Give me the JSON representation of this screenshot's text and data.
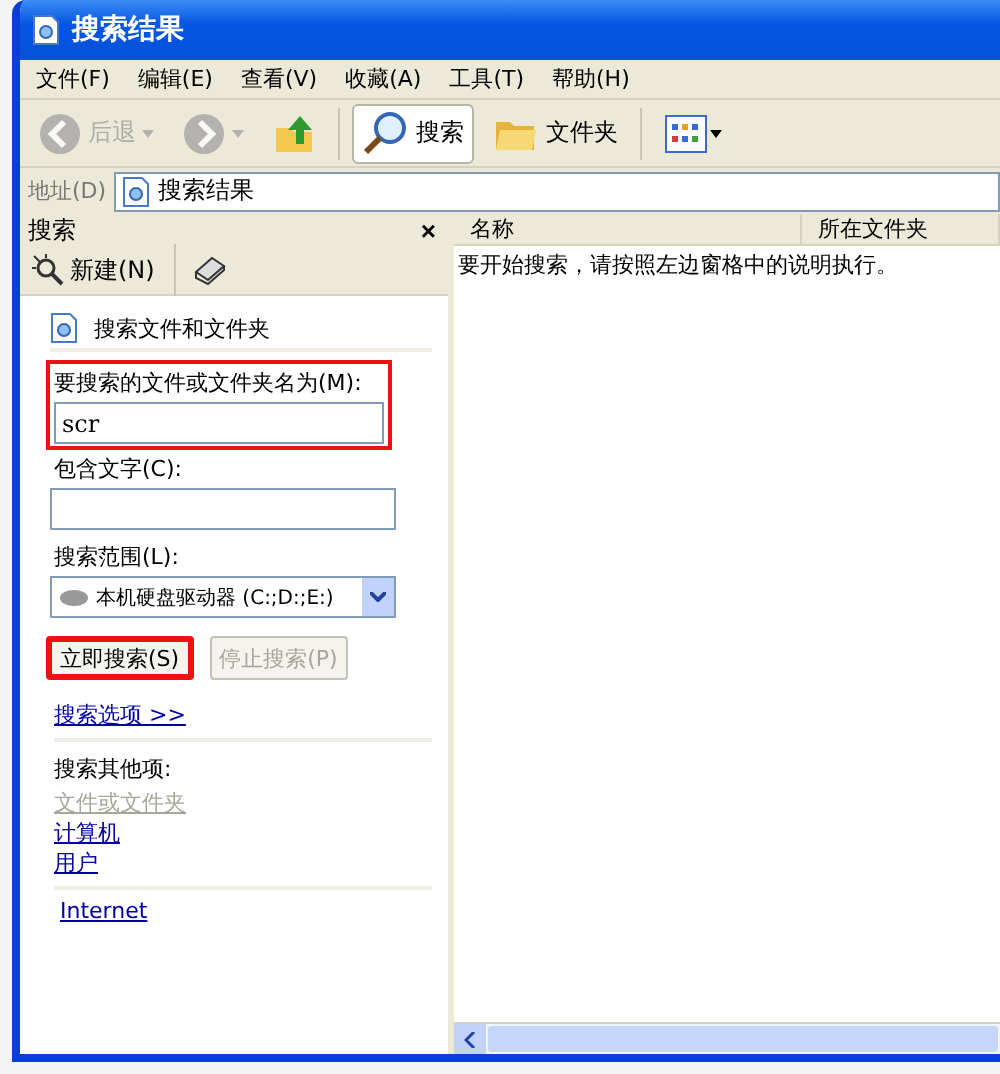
{
  "window": {
    "title": "搜索结果"
  },
  "menu": [
    "文件(F)",
    "编辑(E)",
    "查看(V)",
    "收藏(A)",
    "工具(T)",
    "帮助(H)"
  ],
  "toolbar": [
    {
      "kind": "back",
      "label": "后退",
      "disabled": true,
      "selected": false
    },
    {
      "kind": "forward",
      "disabled": true,
      "selected": false
    },
    {
      "kind": "up",
      "disabled": false,
      "selected": false
    },
    {
      "kind": "search",
      "label": "搜索",
      "disabled": false,
      "selected": true
    },
    {
      "kind": "folders",
      "label": "文件夹",
      "disabled": false,
      "selected": false
    },
    {
      "kind": "views",
      "disabled": false,
      "selected": false
    }
  ],
  "address": {
    "label": "地址(D)",
    "value": "搜索结果"
  },
  "search_pane": {
    "title": "搜索",
    "close": "×",
    "new_button": "新建(N)",
    "heading": "搜索文件和文件夹",
    "name_label": "要搜索的文件或文件夹名为(M):",
    "name_value": "scr",
    "name_highlighted": true,
    "text_label": "包含文字(C):",
    "scope_label": "搜索范围(L):",
    "scope_value": "本机硬盘驱动器 (C:;D:;E:)",
    "buttons": [
      {
        "label": "立即搜索(S)",
        "disabled": false,
        "highlighted": true
      },
      {
        "label": "停止搜索(P)",
        "disabled": true,
        "highlighted": false
      }
    ],
    "options_link": "搜索选项 >>",
    "other_heading": "搜索其他项:",
    "other_links": [
      {
        "label": "文件或文件夹",
        "disabled": true
      },
      {
        "label": "计算机",
        "disabled": false
      },
      {
        "label": "用户",
        "disabled": false
      }
    ],
    "internet_link": "Internet"
  },
  "results": {
    "columns": [
      "名称",
      "所在文件夹"
    ],
    "message": "要开始搜索，请按照左边窗格中的说明执行。"
  }
}
